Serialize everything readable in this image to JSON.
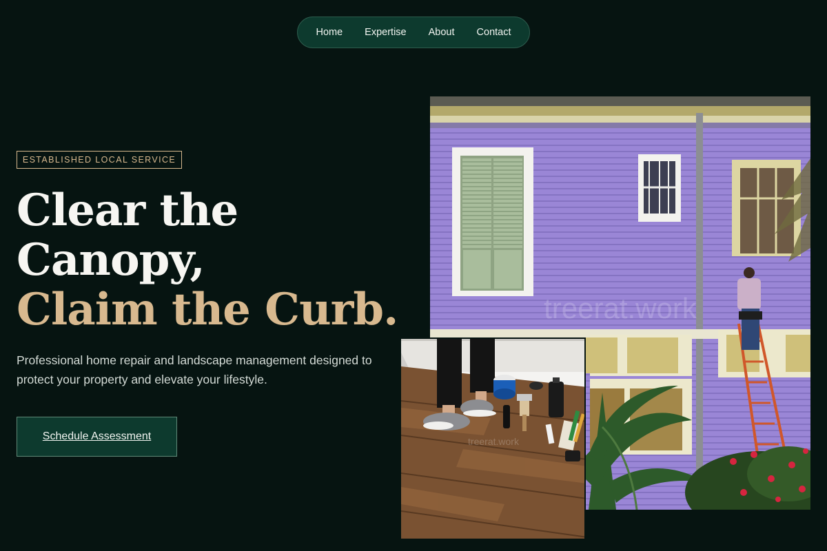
{
  "nav": {
    "items": [
      {
        "label": "Home"
      },
      {
        "label": "Expertise"
      },
      {
        "label": "About"
      },
      {
        "label": "Contact"
      }
    ]
  },
  "hero": {
    "badge": "ESTABLISHED LOCAL SERVICE",
    "headline": {
      "line1": "Clear the",
      "line2": "Canopy,",
      "line3": "Claim the Curb."
    },
    "lede": "Professional home repair and landscape management designed to protect your property and elevate your lifestyle.",
    "cta": "Schedule Assessment"
  },
  "images": {
    "main_watermark": "treerat.work",
    "floor_watermark": "treerat.work"
  },
  "colors": {
    "background": "#061411",
    "accent_gold": "#d8b98f",
    "nav_green": "#0d3a2e"
  }
}
